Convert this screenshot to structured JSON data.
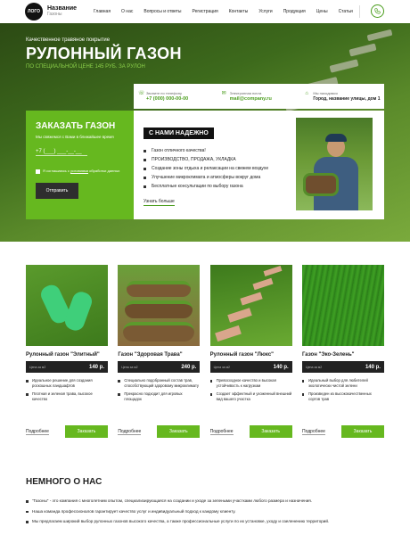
{
  "header": {
    "logo_text": "ЛОГО",
    "brand_name": "Название",
    "brand_sub": "Газоны",
    "nav": [
      "Главная",
      "О нас",
      "Вопросы и ответы",
      "Регистрация",
      "Контакты",
      "Услуги",
      "Продукция",
      "Цены",
      "Статьи"
    ],
    "phone_icon": "phone-icon"
  },
  "hero": {
    "tagline": "Качественное травяное покрытие",
    "title": "РУЛОННЫЙ ГАЗОН",
    "subtitle": "ПО СПЕЦИАЛЬНОЙ ЦЕНЕ 145 РУБ. ЗА РУЛОН"
  },
  "contacts": [
    {
      "label": "Звоните по телефону",
      "value": "+7 (000) 000-00-00",
      "icon": "phone-icon"
    },
    {
      "label": "Электронная почта",
      "value": "mail@company.ru",
      "icon": "mail-icon"
    },
    {
      "label": "Мы находимся",
      "value": "Город, название улицы, дом 1",
      "icon": "location-icon"
    }
  ],
  "order": {
    "title": "ЗАКАЗАТЬ ГАЗОН",
    "description": "Мы свяжемся с Вами в ближайшее время",
    "phone_placeholder": "+7 (___) ___-__-__",
    "agreement_pre": "Я соглашаюсь с ",
    "agreement_link": "условиями",
    "agreement_post": " обработки данных",
    "submit": "Отправить"
  },
  "reliable": {
    "badge": "С НАМИ НАДЕЖНО",
    "items": [
      "Газон отличного качества!",
      "ПРОИЗВОДСТВО, ПРОДАЖА, УКЛАДКА",
      "Создание зоны отдыха и релаксации на свежем воздухе",
      "Улучшение микроклимата и атмосферы вокруг дома",
      "Бесплатные консультации по выбору газона"
    ],
    "more": "Узнать больше"
  },
  "products": [
    {
      "name": "Рулонный газон \"Элитный\"",
      "unit": "Цена за м2",
      "price": "140 р.",
      "features": [
        "Идеальное решение для создания роскошных ландшафтов",
        "Плотная и зеленая трава, высокое качество"
      ],
      "more": "Подробнее",
      "buy": "Заказать"
    },
    {
      "name": "Газон \"Здоровая Трава\"",
      "unit": "Цена за м2",
      "price": "240 р.",
      "features": [
        "Специально подобранный состав трав, способствующий здоровому микроклимату",
        "Прекрасно подходит для игровых площадок"
      ],
      "more": "Подробнее",
      "buy": "Заказать"
    },
    {
      "name": "Рулонный газон \"Люкс\"",
      "unit": "Цена за м2",
      "price": "140 р.",
      "features": [
        "Превосходное качество и высокая устойчивость к нагрузкам",
        "Создает эффектный и ухоженный внешний вид вашего участка"
      ],
      "more": "Подробнее",
      "buy": "Заказать"
    },
    {
      "name": "Газон \"Эко-Зелень\"",
      "unit": "Цена за м2",
      "price": "140 р.",
      "features": [
        "Идеальный выбор для любителей экологически чистой зелени",
        "Произведен из высококачественных сортов трав"
      ],
      "more": "Подробнее",
      "buy": "Заказать"
    }
  ],
  "about": {
    "title": "НЕМНОГО О НАС",
    "items": [
      "\"Газоны\" - это компания с многолетним опытом, специализирующаяся на создании и уходе за зелеными участками любого размера и назначения.",
      "Наша команда профессионалов гарантирует качество услуг и индивидуальный подход к каждому клиенту.",
      "Мы предлагаем широкий выбор рулонных газонов высокого качества, а также профессиональные услуги по их установке, уходу и озеленению территорий."
    ]
  },
  "colors": {
    "accent": "#66b81f",
    "dark": "#222222"
  }
}
